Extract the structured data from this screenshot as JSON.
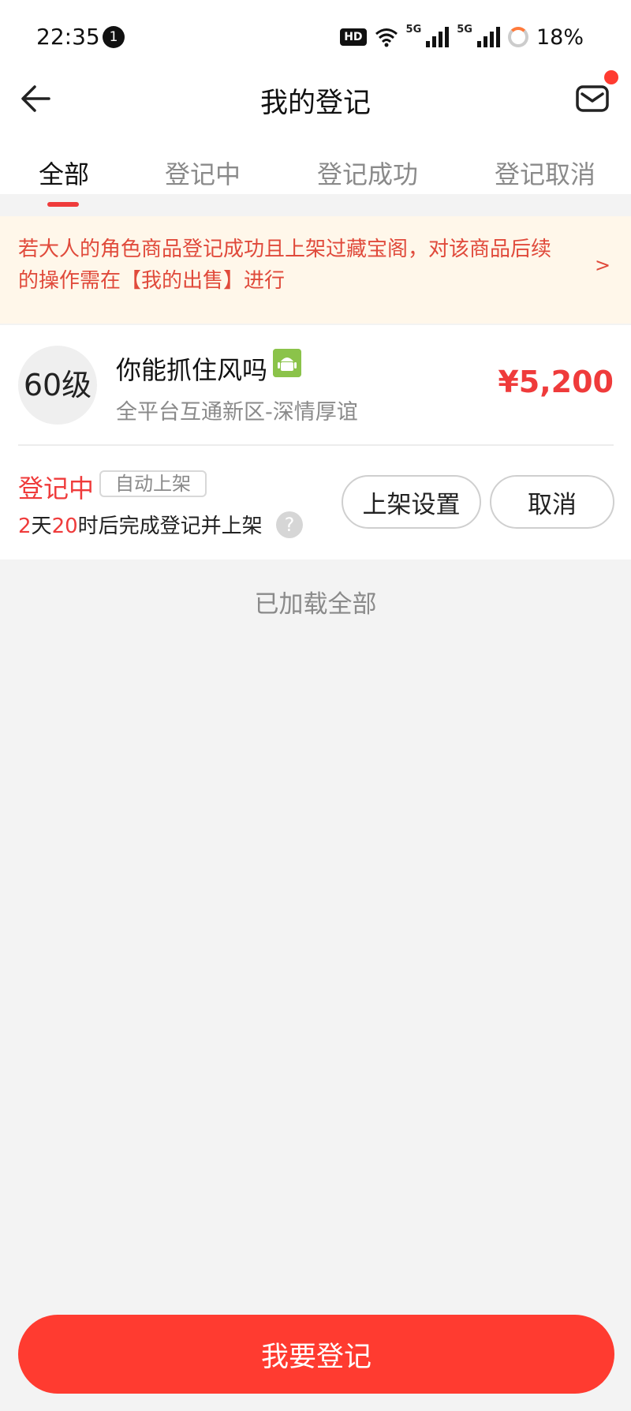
{
  "status_bar": {
    "time": "22:35",
    "notification_count": "1",
    "hd_label": "HD",
    "net_label_1": "5G",
    "net_label_2": "5G",
    "battery": "18%"
  },
  "header": {
    "title": "我的登记",
    "back_icon": "arrow-left-icon",
    "mail_icon": "mail-icon"
  },
  "tabs": [
    {
      "label": "全部",
      "active": true
    },
    {
      "label": "登记中",
      "active": false
    },
    {
      "label": "登记成功",
      "active": false
    },
    {
      "label": "登记取消",
      "active": false
    }
  ],
  "notice": {
    "text": "若大人的角色商品登记成功且上架过藏宝阁，对该商品后续的操作需在【我的出售】进行",
    "arrow": ">"
  },
  "item": {
    "level": "60级",
    "name": "你能抓住风吗",
    "platform_icon": "android-icon",
    "server": "全平台互通新区-深情厚谊",
    "price": "¥5,200",
    "status": "登记中",
    "auto_tag": "自动上架",
    "countdown": {
      "days": "2",
      "days_unit": "天",
      "hours": "20",
      "suffix": "时后完成登记并上架"
    },
    "help_icon": "?",
    "setting_button": "上架设置",
    "cancel_button": "取消"
  },
  "list_footer": "已加载全部",
  "cta_button": "我要登记",
  "colors": {
    "accent": "#ef3b3b",
    "cta": "#ff3b30",
    "notice_bg": "#fff7ea"
  }
}
